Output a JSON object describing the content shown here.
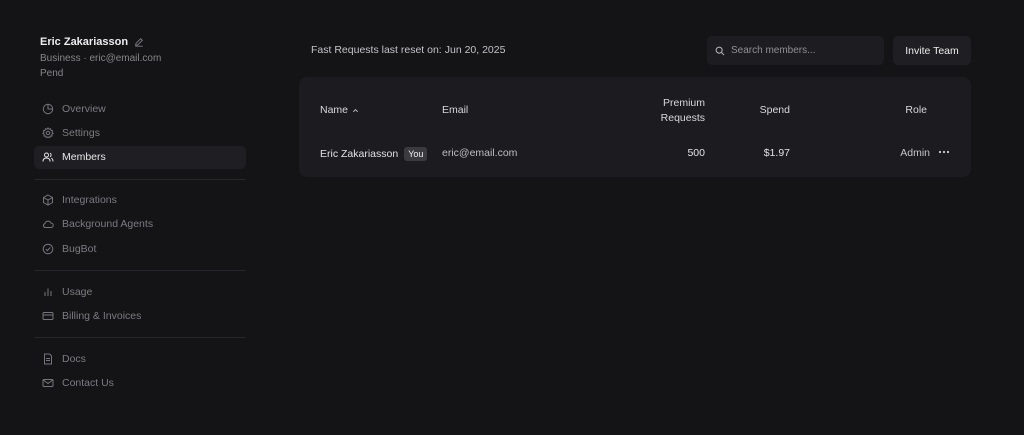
{
  "user": {
    "name": "Eric Zakariasson",
    "plan_email": "Business · eric@email.com",
    "status": "Pend"
  },
  "sidebar": {
    "groups": [
      [
        {
          "label": "Overview",
          "icon": "pie-chart-icon"
        },
        {
          "label": "Settings",
          "icon": "gear-icon"
        },
        {
          "label": "Members",
          "icon": "users-icon",
          "active": true
        }
      ],
      [
        {
          "label": "Integrations",
          "icon": "cube-icon"
        },
        {
          "label": "Background Agents",
          "icon": "cloud-icon"
        },
        {
          "label": "BugBot",
          "icon": "check-circle-icon"
        }
      ],
      [
        {
          "label": "Usage",
          "icon": "bar-chart-icon"
        },
        {
          "label": "Billing & Invoices",
          "icon": "credit-card-icon"
        }
      ],
      [
        {
          "label": "Docs",
          "icon": "document-icon"
        },
        {
          "label": "Contact Us",
          "icon": "mail-icon"
        }
      ]
    ]
  },
  "header": {
    "reset_label": "Fast Requests last reset on:",
    "reset_date": "Jun 20, 2025",
    "search_placeholder": "Search members...",
    "invite_label": "Invite Team"
  },
  "table": {
    "columns": {
      "name": "Name",
      "email": "Email",
      "premium_line1": "Premium",
      "premium_line2": "Requests",
      "spend": "Spend",
      "role": "Role"
    },
    "rows": [
      {
        "name": "Eric Zakariasson",
        "badge": "You",
        "email": "eric@email.com",
        "premium": "500",
        "spend": "$1.97",
        "role": "Admin"
      }
    ]
  },
  "colors": {
    "background": "#141416",
    "card": "#1c1c20",
    "active_item": "#1f1f23"
  }
}
